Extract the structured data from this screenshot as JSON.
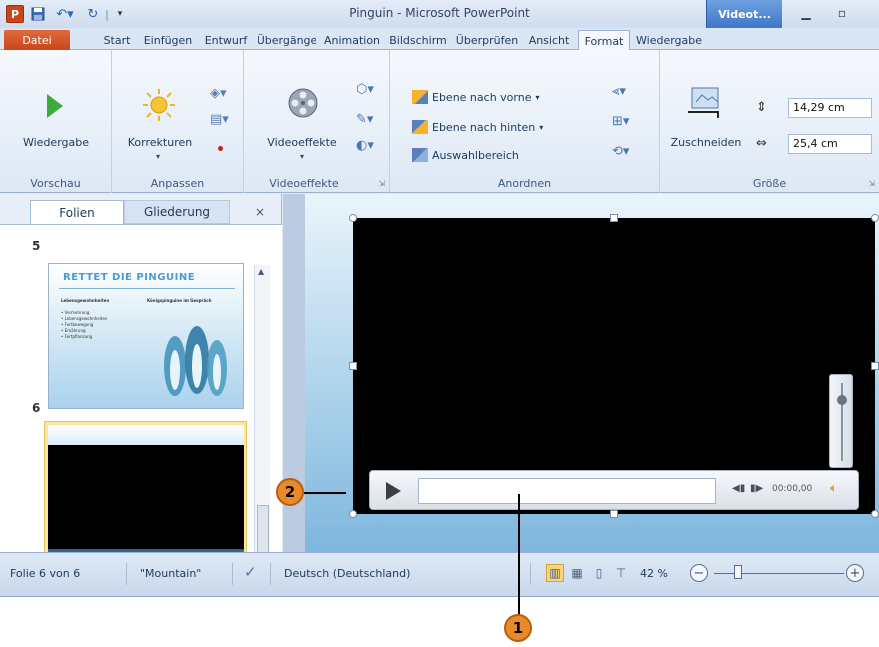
{
  "window": {
    "app_icon": "P",
    "title": "Pinguin - Microsoft PowerPoint",
    "contextual_tab": "Videot..."
  },
  "tabs": [
    "Datei",
    "Start",
    "Einfügen",
    "Entwurf",
    "Übergänge",
    "Animation",
    "Bildschirm",
    "Überprüfen",
    "Ansicht",
    "Format",
    "Wiedergabe"
  ],
  "ribbon": {
    "preview": {
      "play_label": "Wiedergabe",
      "group": "Vorschau"
    },
    "adjust": {
      "corrections_label": "Korrekturen",
      "group": "Anpassen"
    },
    "video_styles": {
      "effects_label": "Videoeffekte",
      "group": "Videoeffekte"
    },
    "arrange": {
      "bring_forward": "Ebene nach vorne",
      "send_backward": "Ebene nach hinten",
      "selection_pane": "Auswahlbereich",
      "group": "Anordnen"
    },
    "size": {
      "crop_label": "Zuschneiden",
      "height": "14,29 cm",
      "width": "25,4 cm",
      "group": "Größe"
    }
  },
  "pane": {
    "tab_slides": "Folien",
    "tab_outline": "Gliederung",
    "close": "×",
    "slides": [
      {
        "number": "5",
        "title": "RETTET DIE PINGUINE",
        "col1": "Lebensgewohnheiten",
        "col2": "Königspinguine im Gespräch",
        "bullets": [
          "Vermehrung",
          "Lebensgewohnheiten",
          "Fortbewegung",
          "Ernährung",
          "Fortpflanzung"
        ]
      },
      {
        "number": "6"
      }
    ]
  },
  "player": {
    "time": "00:00,00"
  },
  "status": {
    "slide_of": "Folie 6 von 6",
    "theme": "\"Mountain\"",
    "language": "Deutsch (Deutschland)",
    "zoom": "42 %"
  },
  "callouts": {
    "one": "1",
    "two": "2"
  },
  "colors": {
    "file_tab": "#c8461a",
    "contextual_tab": "#3e77c8",
    "callout": "#e88a2a"
  }
}
